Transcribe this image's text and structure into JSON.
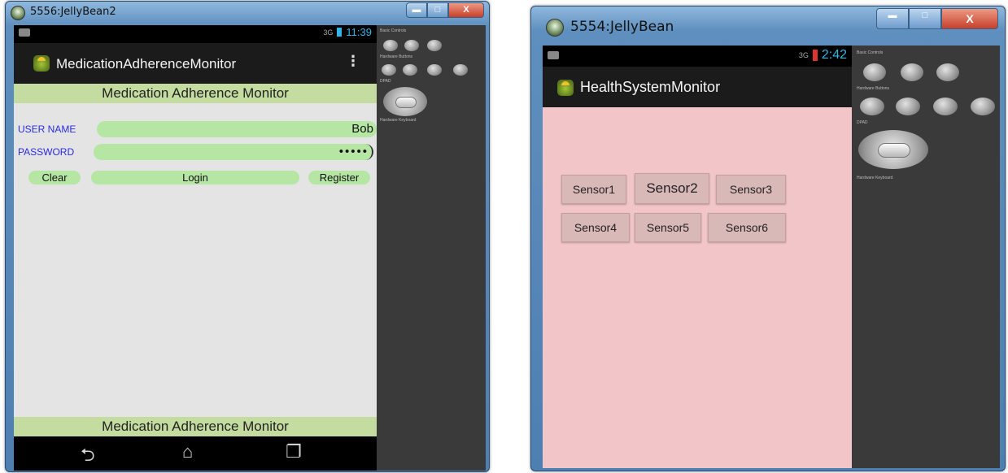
{
  "left_window": {
    "title": "5556:JellyBean2",
    "status_time": "11:39",
    "status_signal": "3G",
    "app_title": "MedicationAdherenceMonitor",
    "overflow_symbol": "⋮",
    "header_banner": "Medication Adherence Monitor",
    "username_label": "USER NAME",
    "username_value": "Bob",
    "password_label": "PASSWORD",
    "password_value": "•••••",
    "clear_label": "Clear",
    "login_label": "Login",
    "register_label": "Register",
    "footer_banner": "Medication Adherence Monitor"
  },
  "right_window": {
    "title": "5554:JellyBean",
    "status_time": "2:42",
    "status_signal": "3G",
    "app_title": "HealthSystemMonitor",
    "sensors": [
      "Sensor1",
      "Sensor2",
      "Sensor3",
      "Sensor4",
      "Sensor5",
      "Sensor6"
    ]
  },
  "window_controls": {
    "minimize": "▬",
    "maximize": "□",
    "close": "X"
  },
  "colors": {
    "left_background": "#e4e4e4",
    "right_background": "#f2c6c9",
    "banner": "#c4dca0",
    "input_fill": "#b6e6a4",
    "sensor_button": "#d9b8b8",
    "holo_blue": "#33b5e5"
  }
}
